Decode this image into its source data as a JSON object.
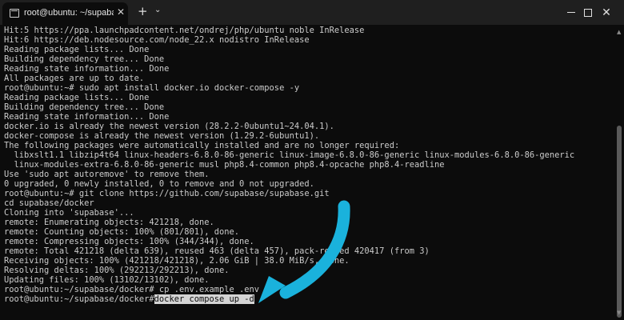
{
  "window": {
    "tab_title": "root@ubuntu: ~/supabase/dc",
    "close_tab": "✕",
    "new_tab": "+",
    "dropdown": "⌄",
    "close_window": "✕"
  },
  "terminal": {
    "lines": [
      "Hit:5 https://ppa.launchpadcontent.net/ondrej/php/ubuntu noble InRelease",
      "Hit:6 https://deb.nodesource.com/node_22.x nodistro InRelease",
      "Reading package lists... Done",
      "Building dependency tree... Done",
      "Reading state information... Done",
      "All packages are up to date.",
      "root@ubuntu:~# sudo apt install docker.io docker-compose -y",
      "Reading package lists... Done",
      "Building dependency tree... Done",
      "Reading state information... Done",
      "docker.io is already the newest version (28.2.2-0ubuntu1~24.04.1).",
      "docker-compose is already the newest version (1.29.2-6ubuntu1).",
      "The following packages were automatically installed and are no longer required:",
      "  libxslt1.1 libzip4t64 linux-headers-6.8.0-86-generic linux-image-6.8.0-86-generic linux-modules-6.8.0-86-generic",
      "  linux-modules-extra-6.8.0-86-generic musl php8.4-common php8.4-opcache php8.4-readline",
      "Use 'sudo apt autoremove' to remove them.",
      "0 upgraded, 0 newly installed, 0 to remove and 0 not upgraded.",
      "root@ubuntu:~# git clone https://github.com/supabase/supabase.git",
      "cd supabase/docker",
      "Cloning into 'supabase'...",
      "remote: Enumerating objects: 421218, done.",
      "remote: Counting objects: 100% (801/801), done.",
      "remote: Compressing objects: 100% (344/344), done.",
      "remote: Total 421218 (delta 639), reused 463 (delta 457), pack-reused 420417 (from 3)",
      "Receiving objects: 100% (421218/421218), 2.06 GiB | 38.0 MiB/s, done.",
      "Resolving deltas: 100% (292213/292213), done.",
      "Updating files: 100% (13102/13102), done.",
      "root@ubuntu:~/supabase/docker# cp .env.example .env"
    ],
    "prompt": "root@ubuntu:~/supabase/docker#",
    "current_command": "docker compose up -d"
  },
  "annotation": {
    "arrow_color": "#1ab2dc"
  },
  "colors": {
    "background": "#0c0c0c",
    "titlebar": "#1f1f1f",
    "text": "#cccccc"
  }
}
